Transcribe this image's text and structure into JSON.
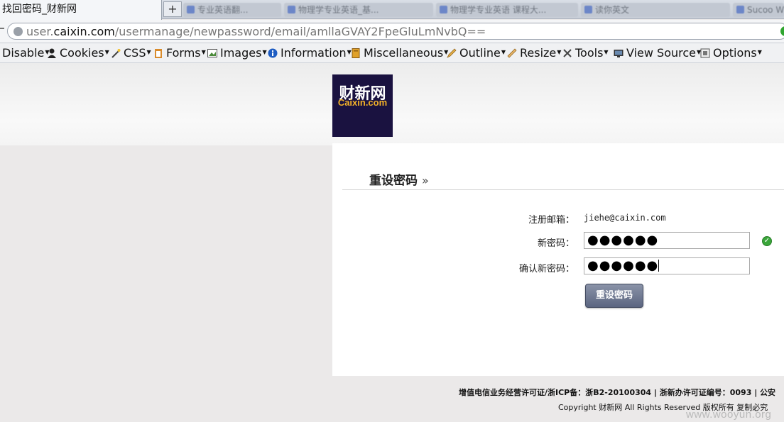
{
  "browser": {
    "active_tab_title": "找回密码_财新网",
    "new_tab_label": "+",
    "background_tabs": [
      "专业英语翻...",
      "物理学专业英语_基...",
      "物理学专业英语 课程大...",
      "读你英文",
      "Sucoo Web..."
    ],
    "url": {
      "prefix": "user.",
      "domain": "caixin.com",
      "path": "/usermanage/newpassword/email/amllaGVAY2FpeGluLmNvbQ=="
    }
  },
  "devtoolbar": {
    "items": [
      {
        "label": "Disable",
        "icon": "none"
      },
      {
        "label": "Cookies",
        "icon": "cookie-person-icon"
      },
      {
        "label": "CSS",
        "icon": "wand-icon"
      },
      {
        "label": "Forms",
        "icon": "clipboard-icon"
      },
      {
        "label": "Images",
        "icon": "image-icon"
      },
      {
        "label": "Information",
        "icon": "info-icon"
      },
      {
        "label": "Miscellaneous",
        "icon": "book-icon"
      },
      {
        "label": "Outline",
        "icon": "pencil-icon"
      },
      {
        "label": "Resize",
        "icon": "ruler-icon"
      },
      {
        "label": "Tools",
        "icon": "tools-icon"
      },
      {
        "label": "View Source",
        "icon": "monitor-icon"
      },
      {
        "label": "Options",
        "icon": "options-icon"
      }
    ]
  },
  "logo": {
    "cn": "财新网",
    "en": "Caixin.com"
  },
  "form": {
    "title": "重设密码",
    "title_arrow": "»",
    "email_label": "注册邮箱：",
    "email_value": "jiehe@caixin.com",
    "new_password_label": "新密码：",
    "new_password_value": "●●●●●●",
    "confirm_password_label": "确认新密码：",
    "confirm_password_value": "●●●●●●",
    "submit_label": "重设密码",
    "check_glyph": "✓"
  },
  "footer": {
    "license": "增值电信业务经营许可证/浙ICP备：浙B2-20100304 | 浙新办许可证编号：0093 | 公安",
    "copyright": "Copyright 财新网 All Rights Reserved 版权所有 复制必究"
  },
  "watermark": "www.wooyun.org",
  "colors": {
    "logo_bg": "#1a1240",
    "logo_accent": "#f3b128",
    "valid_green": "#3aa63a"
  }
}
